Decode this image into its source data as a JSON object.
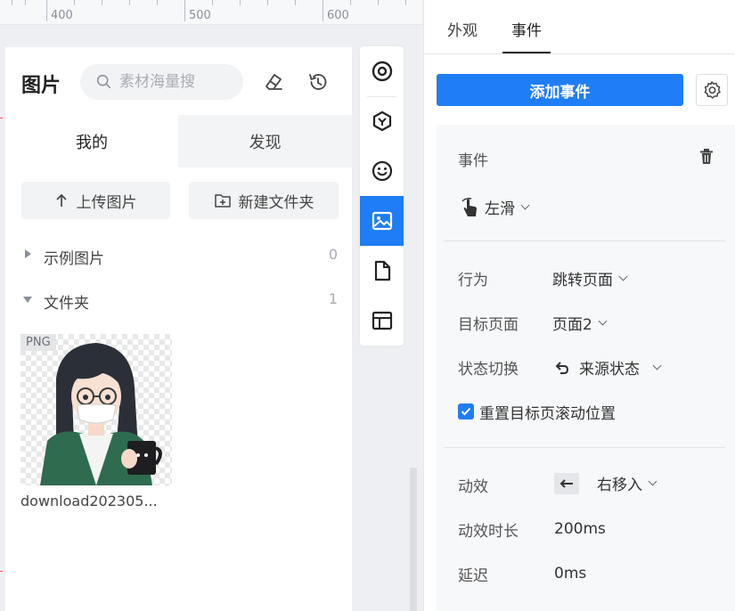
{
  "ruler": {
    "labels": [
      "400",
      "500",
      "600"
    ]
  },
  "library": {
    "title": "图片",
    "search_placeholder": "素材海量搜",
    "tabs": [
      "我的",
      "发现"
    ],
    "upload_label": "上传图片",
    "new_folder_label": "新建文件夹",
    "tree": [
      {
        "label": "示例图片",
        "count": "0",
        "expanded": false
      },
      {
        "label": "文件夹",
        "count": "1",
        "expanded": true
      }
    ],
    "image": {
      "tag": "PNG",
      "name": "download202305..."
    }
  },
  "toolbar": {
    "items": [
      "target-icon",
      "component-icon",
      "emoji-icon",
      "image-icon",
      "file-icon",
      "layout-icon"
    ],
    "active": "image-icon"
  },
  "panel": {
    "tabs": [
      "外观",
      "事件"
    ],
    "active_tab": "事件",
    "add_event_label": "添加事件",
    "event_header": "事件",
    "trigger": "左滑",
    "rows": {
      "behavior_label": "行为",
      "behavior_value": "跳转页面",
      "target_label": "目标页面",
      "target_value": "页面2",
      "state_label": "状态切换",
      "state_value": "来源状态",
      "reset_scroll_label": "重置目标页滚动位置",
      "reset_scroll_checked": true,
      "anim_label": "动效",
      "anim_value": "右移入",
      "duration_label": "动效时长",
      "duration_value": "200ms",
      "delay_label": "延迟",
      "delay_value": "0ms"
    }
  },
  "colors": {
    "accent": "#1f7df5",
    "panel_bg": "#f7f8fa"
  }
}
